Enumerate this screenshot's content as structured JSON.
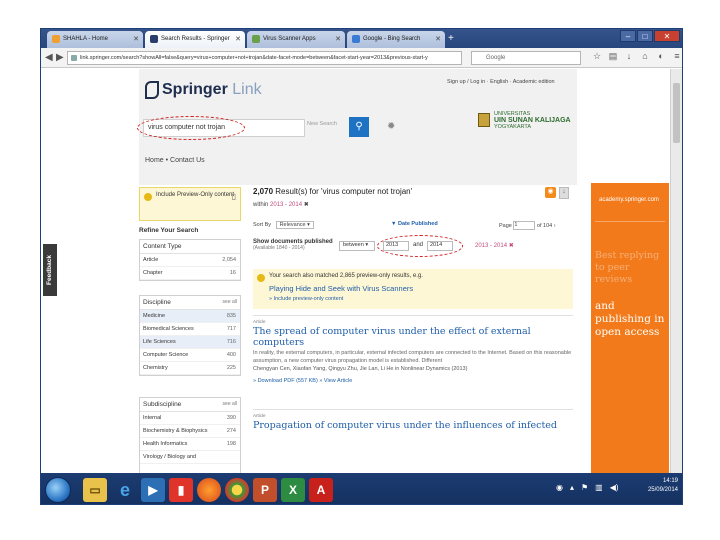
{
  "browser": {
    "tabs": [
      {
        "label": "SHAHLA - Home",
        "active": false
      },
      {
        "label": "Search Results - Springer",
        "active": true
      },
      {
        "label": "Virus Scanner Apps",
        "active": false
      },
      {
        "label": "Google - Bing Search",
        "active": false
      }
    ],
    "new_tab_label": "+",
    "url": "link.springer.com/search?showAll=false&query=virus+computer+not+trojan&date-facet-mode=between&facet-start-year=2013&previous-start-y",
    "search_placeholder": "Google",
    "window_buttons": [
      "–",
      "□",
      "✕"
    ]
  },
  "site": {
    "logo_word": "Springer",
    "logo_suffix": "Link",
    "top_links": "Sign up / Log in  ·  English  ·  Academic edition",
    "search_value": "virus computer not trojan",
    "new_search_label": "New Search",
    "institution_line1": "UNIVERSITAS",
    "institution_line2": "UIN SUNAN KALIJAGA",
    "institution_line3": "YOGYAKARTA",
    "crumbs": "Home  •  Contact Us"
  },
  "left": {
    "preview_text": "Include Preview-Only content",
    "refine_label": "Refine Your Search",
    "content_type": {
      "title": "Content Type",
      "rows": [
        {
          "label": "Article",
          "count": "2,054"
        },
        {
          "label": "Chapter",
          "count": "16"
        }
      ]
    },
    "discipline": {
      "title": "Discipline",
      "see_all": "see all",
      "rows": [
        {
          "label": "Medicine",
          "count": "835"
        },
        {
          "label": "Biomedical Sciences",
          "count": "717"
        },
        {
          "label": "Life Sciences",
          "count": "716"
        },
        {
          "label": "Computer Science",
          "count": "400"
        },
        {
          "label": "Chemistry",
          "count": "225"
        }
      ]
    },
    "subdiscipline": {
      "title": "Subdiscipline",
      "see_all": "see all",
      "rows": [
        {
          "label": "Internal",
          "count": "390"
        },
        {
          "label": "Biochemistry & Biophysics",
          "count": "274"
        },
        {
          "label": "Health Informatics",
          "count": "198"
        },
        {
          "label": "Virology / Biology and",
          "count": ""
        }
      ]
    }
  },
  "main": {
    "count_number": "2,070",
    "count_text": "Result(s) for 'virus computer not trojan'",
    "within_prefix": "within",
    "within_range": "2013 - 2014",
    "sort_label": "Sort By",
    "sort_value": "Relevance",
    "date_published_label": "▼ Date Published",
    "page_label": "Page",
    "page_value": "1",
    "page_of": "of 104",
    "show_docs_label": "Show documents published",
    "show_docs_sub": "(Available 1840 - 2014)",
    "between_value": "between",
    "year_from": "2013",
    "and_label": "and",
    "year_to": "2014",
    "range_text": "2013 - 2014",
    "notice_text": "Your search also matched 2,865 preview-only results, e.g.",
    "notice_link": "Playing Hide and Seek with Virus Scanners",
    "notice_include": "» Include preview-only content",
    "results": [
      {
        "type": "Article",
        "title": "The spread of computer virus under the effect of external computers",
        "snippet": "In reality, the external computers, in particular, external infected computers are connected to the Internet. Based on this reasonable assumption, a new computer virus propagation model is established. Different",
        "authors": "Chengyan Cen, Xiaofan Yang, Qingyu Zhu, Jie Lan, Li He in Nonlinear Dynamics (2013)",
        "actions": "» Download PDF (557 KB)   » View Article"
      },
      {
        "type": "Article",
        "title": "Propagation of computer virus under the influences of infected",
        "snippet": "",
        "authors": "",
        "actions": ""
      }
    ]
  },
  "ad": {
    "site": "academy.springer.com",
    "faded": "Best replying to peer reviews",
    "strong": "and publishing in open access"
  },
  "feedback_label": "Feedback",
  "taskbar": {
    "time": "14:19",
    "date": "25/09/2014"
  }
}
